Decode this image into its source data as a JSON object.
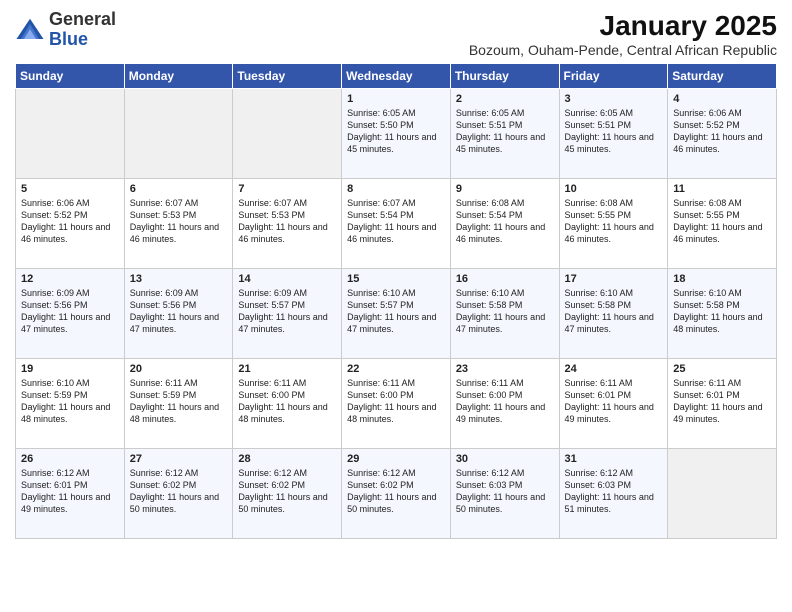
{
  "header": {
    "logo_general": "General",
    "logo_blue": "Blue",
    "main_title": "January 2025",
    "subtitle": "Bozoum, Ouham-Pende, Central African Republic"
  },
  "days_of_week": [
    "Sunday",
    "Monday",
    "Tuesday",
    "Wednesday",
    "Thursday",
    "Friday",
    "Saturday"
  ],
  "weeks": [
    [
      {
        "day": "",
        "content": ""
      },
      {
        "day": "",
        "content": ""
      },
      {
        "day": "",
        "content": ""
      },
      {
        "day": "1",
        "content": "Sunrise: 6:05 AM\nSunset: 5:50 PM\nDaylight: 11 hours\nand 45 minutes."
      },
      {
        "day": "2",
        "content": "Sunrise: 6:05 AM\nSunset: 5:51 PM\nDaylight: 11 hours\nand 45 minutes."
      },
      {
        "day": "3",
        "content": "Sunrise: 6:05 AM\nSunset: 5:51 PM\nDaylight: 11 hours\nand 45 minutes."
      },
      {
        "day": "4",
        "content": "Sunrise: 6:06 AM\nSunset: 5:52 PM\nDaylight: 11 hours\nand 46 minutes."
      }
    ],
    [
      {
        "day": "5",
        "content": "Sunrise: 6:06 AM\nSunset: 5:52 PM\nDaylight: 11 hours\nand 46 minutes."
      },
      {
        "day": "6",
        "content": "Sunrise: 6:07 AM\nSunset: 5:53 PM\nDaylight: 11 hours\nand 46 minutes."
      },
      {
        "day": "7",
        "content": "Sunrise: 6:07 AM\nSunset: 5:53 PM\nDaylight: 11 hours\nand 46 minutes."
      },
      {
        "day": "8",
        "content": "Sunrise: 6:07 AM\nSunset: 5:54 PM\nDaylight: 11 hours\nand 46 minutes."
      },
      {
        "day": "9",
        "content": "Sunrise: 6:08 AM\nSunset: 5:54 PM\nDaylight: 11 hours\nand 46 minutes."
      },
      {
        "day": "10",
        "content": "Sunrise: 6:08 AM\nSunset: 5:55 PM\nDaylight: 11 hours\nand 46 minutes."
      },
      {
        "day": "11",
        "content": "Sunrise: 6:08 AM\nSunset: 5:55 PM\nDaylight: 11 hours\nand 46 minutes."
      }
    ],
    [
      {
        "day": "12",
        "content": "Sunrise: 6:09 AM\nSunset: 5:56 PM\nDaylight: 11 hours\nand 47 minutes."
      },
      {
        "day": "13",
        "content": "Sunrise: 6:09 AM\nSunset: 5:56 PM\nDaylight: 11 hours\nand 47 minutes."
      },
      {
        "day": "14",
        "content": "Sunrise: 6:09 AM\nSunset: 5:57 PM\nDaylight: 11 hours\nand 47 minutes."
      },
      {
        "day": "15",
        "content": "Sunrise: 6:10 AM\nSunset: 5:57 PM\nDaylight: 11 hours\nand 47 minutes."
      },
      {
        "day": "16",
        "content": "Sunrise: 6:10 AM\nSunset: 5:58 PM\nDaylight: 11 hours\nand 47 minutes."
      },
      {
        "day": "17",
        "content": "Sunrise: 6:10 AM\nSunset: 5:58 PM\nDaylight: 11 hours\nand 47 minutes."
      },
      {
        "day": "18",
        "content": "Sunrise: 6:10 AM\nSunset: 5:58 PM\nDaylight: 11 hours\nand 48 minutes."
      }
    ],
    [
      {
        "day": "19",
        "content": "Sunrise: 6:10 AM\nSunset: 5:59 PM\nDaylight: 11 hours\nand 48 minutes."
      },
      {
        "day": "20",
        "content": "Sunrise: 6:11 AM\nSunset: 5:59 PM\nDaylight: 11 hours\nand 48 minutes."
      },
      {
        "day": "21",
        "content": "Sunrise: 6:11 AM\nSunset: 6:00 PM\nDaylight: 11 hours\nand 48 minutes."
      },
      {
        "day": "22",
        "content": "Sunrise: 6:11 AM\nSunset: 6:00 PM\nDaylight: 11 hours\nand 48 minutes."
      },
      {
        "day": "23",
        "content": "Sunrise: 6:11 AM\nSunset: 6:00 PM\nDaylight: 11 hours\nand 49 minutes."
      },
      {
        "day": "24",
        "content": "Sunrise: 6:11 AM\nSunset: 6:01 PM\nDaylight: 11 hours\nand 49 minutes."
      },
      {
        "day": "25",
        "content": "Sunrise: 6:11 AM\nSunset: 6:01 PM\nDaylight: 11 hours\nand 49 minutes."
      }
    ],
    [
      {
        "day": "26",
        "content": "Sunrise: 6:12 AM\nSunset: 6:01 PM\nDaylight: 11 hours\nand 49 minutes."
      },
      {
        "day": "27",
        "content": "Sunrise: 6:12 AM\nSunset: 6:02 PM\nDaylight: 11 hours\nand 50 minutes."
      },
      {
        "day": "28",
        "content": "Sunrise: 6:12 AM\nSunset: 6:02 PM\nDaylight: 11 hours\nand 50 minutes."
      },
      {
        "day": "29",
        "content": "Sunrise: 6:12 AM\nSunset: 6:02 PM\nDaylight: 11 hours\nand 50 minutes."
      },
      {
        "day": "30",
        "content": "Sunrise: 6:12 AM\nSunset: 6:03 PM\nDaylight: 11 hours\nand 50 minutes."
      },
      {
        "day": "31",
        "content": "Sunrise: 6:12 AM\nSunset: 6:03 PM\nDaylight: 11 hours\nand 51 minutes."
      },
      {
        "day": "",
        "content": ""
      }
    ]
  ]
}
